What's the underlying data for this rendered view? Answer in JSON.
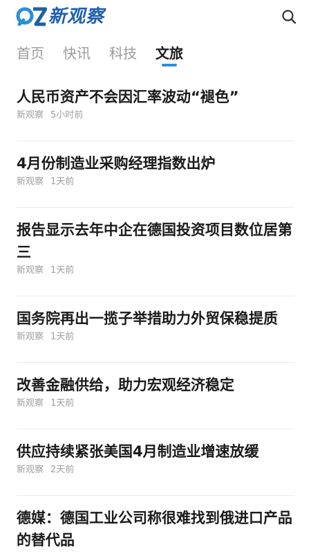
{
  "header": {
    "logo_text": "新观察",
    "brand_color": "#1f5fa8",
    "search_icon": "search-icon"
  },
  "tabs": [
    {
      "label": "首页",
      "active": false
    },
    {
      "label": "快讯",
      "active": false
    },
    {
      "label": "科技",
      "active": false
    },
    {
      "label": "文旅",
      "active": true
    }
  ],
  "accent_color": "#2a8fd8",
  "news": [
    {
      "title": "人民币资产不会因汇率波动“褪色”",
      "source": "新观察",
      "time": "5小时前"
    },
    {
      "title": "4月份制造业采购经理指数出炉",
      "source": "新观察",
      "time": "1天前"
    },
    {
      "title": "报告显示去年中企在德国投资项目数位居第三",
      "source": "新观察",
      "time": "1天前"
    },
    {
      "title": "国务院再出一揽子举措助力外贸保稳提质",
      "source": "新观察",
      "time": "1天前"
    },
    {
      "title": "改善金融供给，助力宏观经济稳定",
      "source": "新观察",
      "time": "1天前"
    },
    {
      "title": "供应持续紧张美国4月制造业增速放缓",
      "source": "新观察",
      "time": "2天前"
    },
    {
      "title": "德媒：德国工业公司称很难找到俄进口产品的替代品",
      "source": "",
      "time": ""
    }
  ]
}
